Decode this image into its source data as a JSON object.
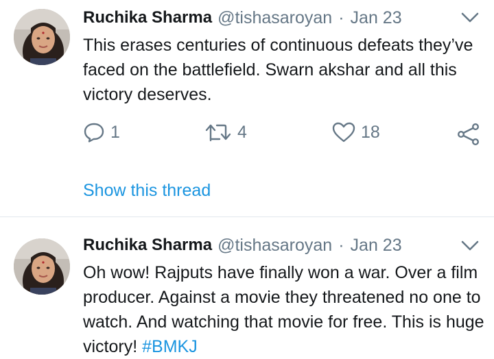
{
  "tweets": [
    {
      "author_name": "Ruchika Sharma",
      "handle": "@tishasaroyan",
      "separator": "·",
      "date": "Jan 23",
      "text": "This erases centuries of continuous defeats they’ve faced on the battlefield. Swarn akshar and all this victory deserves.",
      "reply_count": "1",
      "retweet_count": "4",
      "like_count": "18",
      "show_thread_label": "Show this thread"
    },
    {
      "author_name": "Ruchika Sharma",
      "handle": "@tishasaroyan",
      "separator": "·",
      "date": "Jan 23",
      "text": "Oh wow! Rajputs have finally won a war. Over a film producer. Against a movie they threatened no one to watch. And watching that movie for free. This is huge victory! ",
      "hashtag": "#BMKJ"
    }
  ],
  "colors": {
    "link": "#1b95e0",
    "secondary_text": "#657786",
    "divider": "#e1e8ed"
  },
  "icons": [
    "chevron-down-icon",
    "reply-icon",
    "retweet-icon",
    "like-icon",
    "share-icon"
  ]
}
